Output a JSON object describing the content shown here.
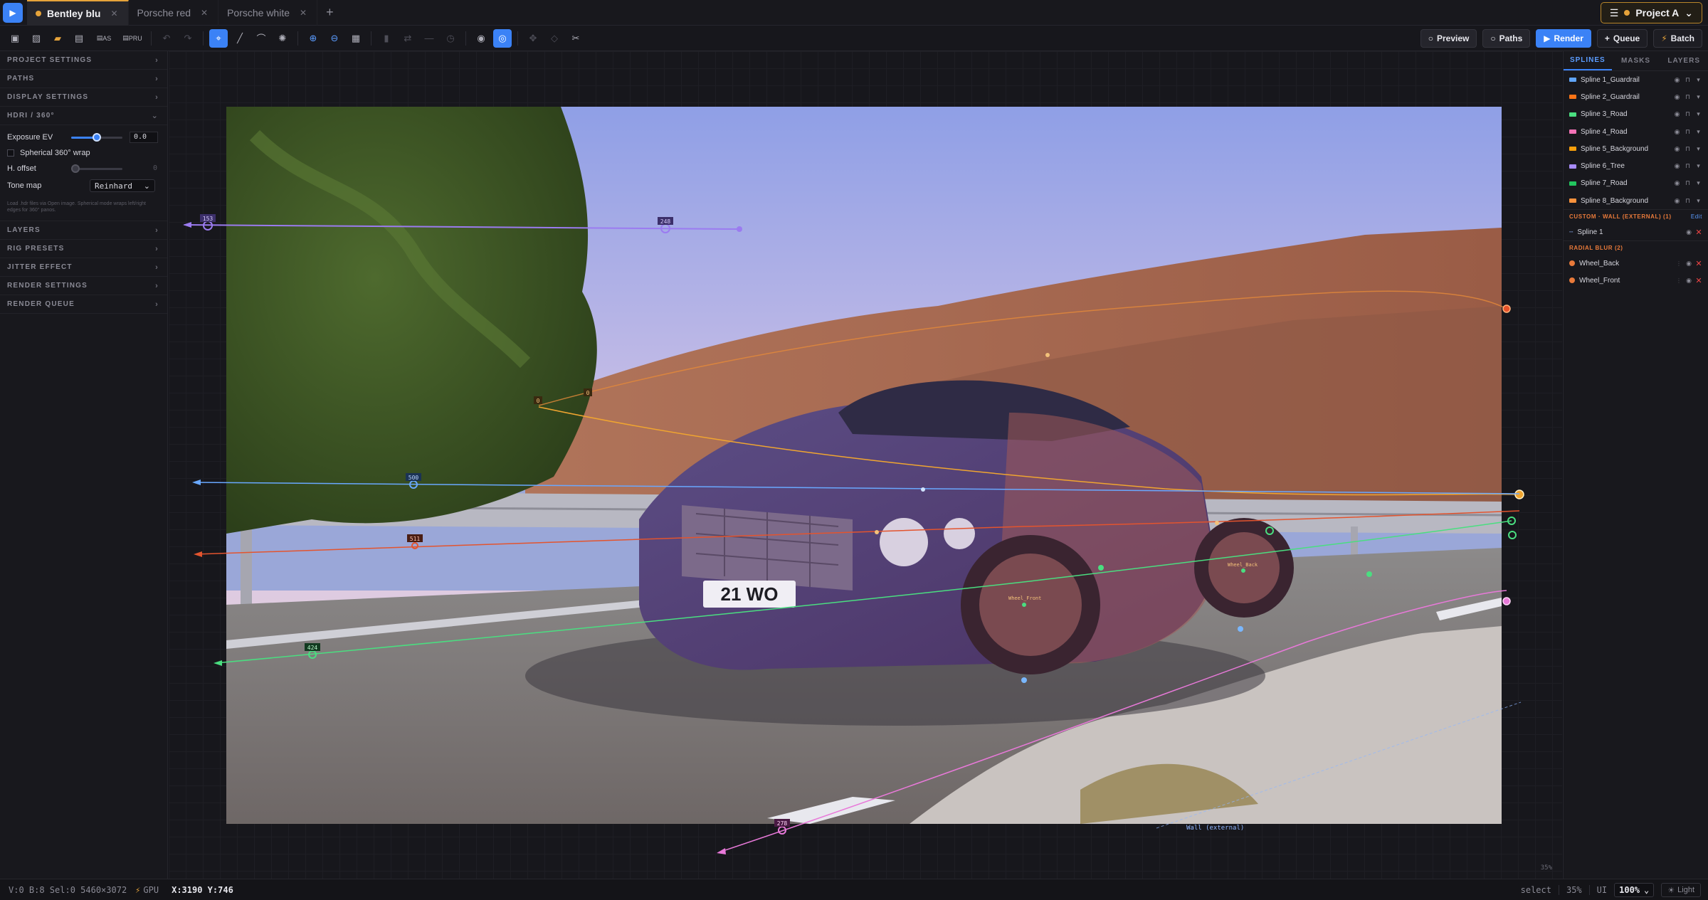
{
  "tabs": [
    {
      "label": "Bentley blu",
      "active": true
    },
    {
      "label": "Porsche red",
      "active": false
    },
    {
      "label": "Porsche white",
      "active": false
    }
  ],
  "project": {
    "label": "Project A"
  },
  "toolbar": {
    "save_as_label": "AS",
    "save_pru_label": "PRU",
    "preview_label": "Preview",
    "paths_label": "Paths",
    "render_label": "Render",
    "queue_label": "Queue",
    "batch_label": "Batch"
  },
  "left_panel": {
    "sections": {
      "project_settings": "PROJECT SETTINGS",
      "paths": "PATHS",
      "display_settings": "DISPLAY SETTINGS",
      "hdri": "HDRI / 360°",
      "layers": "LAYERS",
      "rig_presets": "RIG PRESETS",
      "jitter_effect": "JITTER EFFECT",
      "render_settings": "RENDER SETTINGS",
      "render_queue": "RENDER QUEUE"
    },
    "hdri": {
      "exposure_label": "Exposure EV",
      "exposure_value": "0.0",
      "exposure_fraction": 0.5,
      "spherical_label": "Spherical 360° wrap",
      "spherical_checked": false,
      "h_offset_label": "H. offset",
      "h_offset_value": "0",
      "tone_map_label": "Tone map",
      "tone_map_value": "Reinhard",
      "hint": "Load .hdr files via Open image. Spherical mode wraps left/right edges for 360° panos."
    }
  },
  "right_panel": {
    "tabs": [
      "SPLINES",
      "MASKS",
      "LAYERS"
    ],
    "active_tab": "SPLINES",
    "splines": [
      {
        "name": "Spline 1_Guardrail",
        "color": "#60a5fa"
      },
      {
        "name": "Spline 2_Guardrail",
        "color": "#f97316"
      },
      {
        "name": "Spline 3_Road",
        "color": "#4ade80"
      },
      {
        "name": "Spline 4_Road",
        "color": "#f472b6"
      },
      {
        "name": "Spline 5_Background",
        "color": "#f59e0b"
      },
      {
        "name": "Spline 6_Tree",
        "color": "#a78bfa"
      },
      {
        "name": "Spline 7_Road",
        "color": "#22c55e"
      },
      {
        "name": "Spline 8_Background",
        "color": "#fb923c"
      }
    ],
    "custom_group": {
      "label": "CUSTOM · WALL (EXTERNAL) (1)",
      "edit_label": "Edit",
      "items": [
        {
          "name": "Spline 1"
        }
      ]
    },
    "radial_group": {
      "label": "RADIAL BLUR (2)",
      "items": [
        {
          "name": "Wheel_Back"
        },
        {
          "name": "Wheel_Front"
        }
      ]
    }
  },
  "canvas": {
    "labels": {
      "tree_left": "153",
      "tree_mid": "248",
      "guard_top": "500",
      "guard_low": "511",
      "road_left": "424",
      "bg_a": "0",
      "bg_b": "0",
      "wall_bottom": "278",
      "wall_caption": "Wall (external)",
      "wheel_front": "Wheel_Front",
      "wheel_back": "Wheel_Back"
    },
    "zoom_corner": "35%",
    "plate": "21 WO"
  },
  "statusbar": {
    "stats": "V:0 B:8 Sel:0 5460×3072",
    "gpu": "GPU",
    "coords": "X:3190 Y:746",
    "mode": "select",
    "zoom": "35%",
    "ui_label": "UI",
    "ui_scale": "100%",
    "light_label": "Light"
  }
}
